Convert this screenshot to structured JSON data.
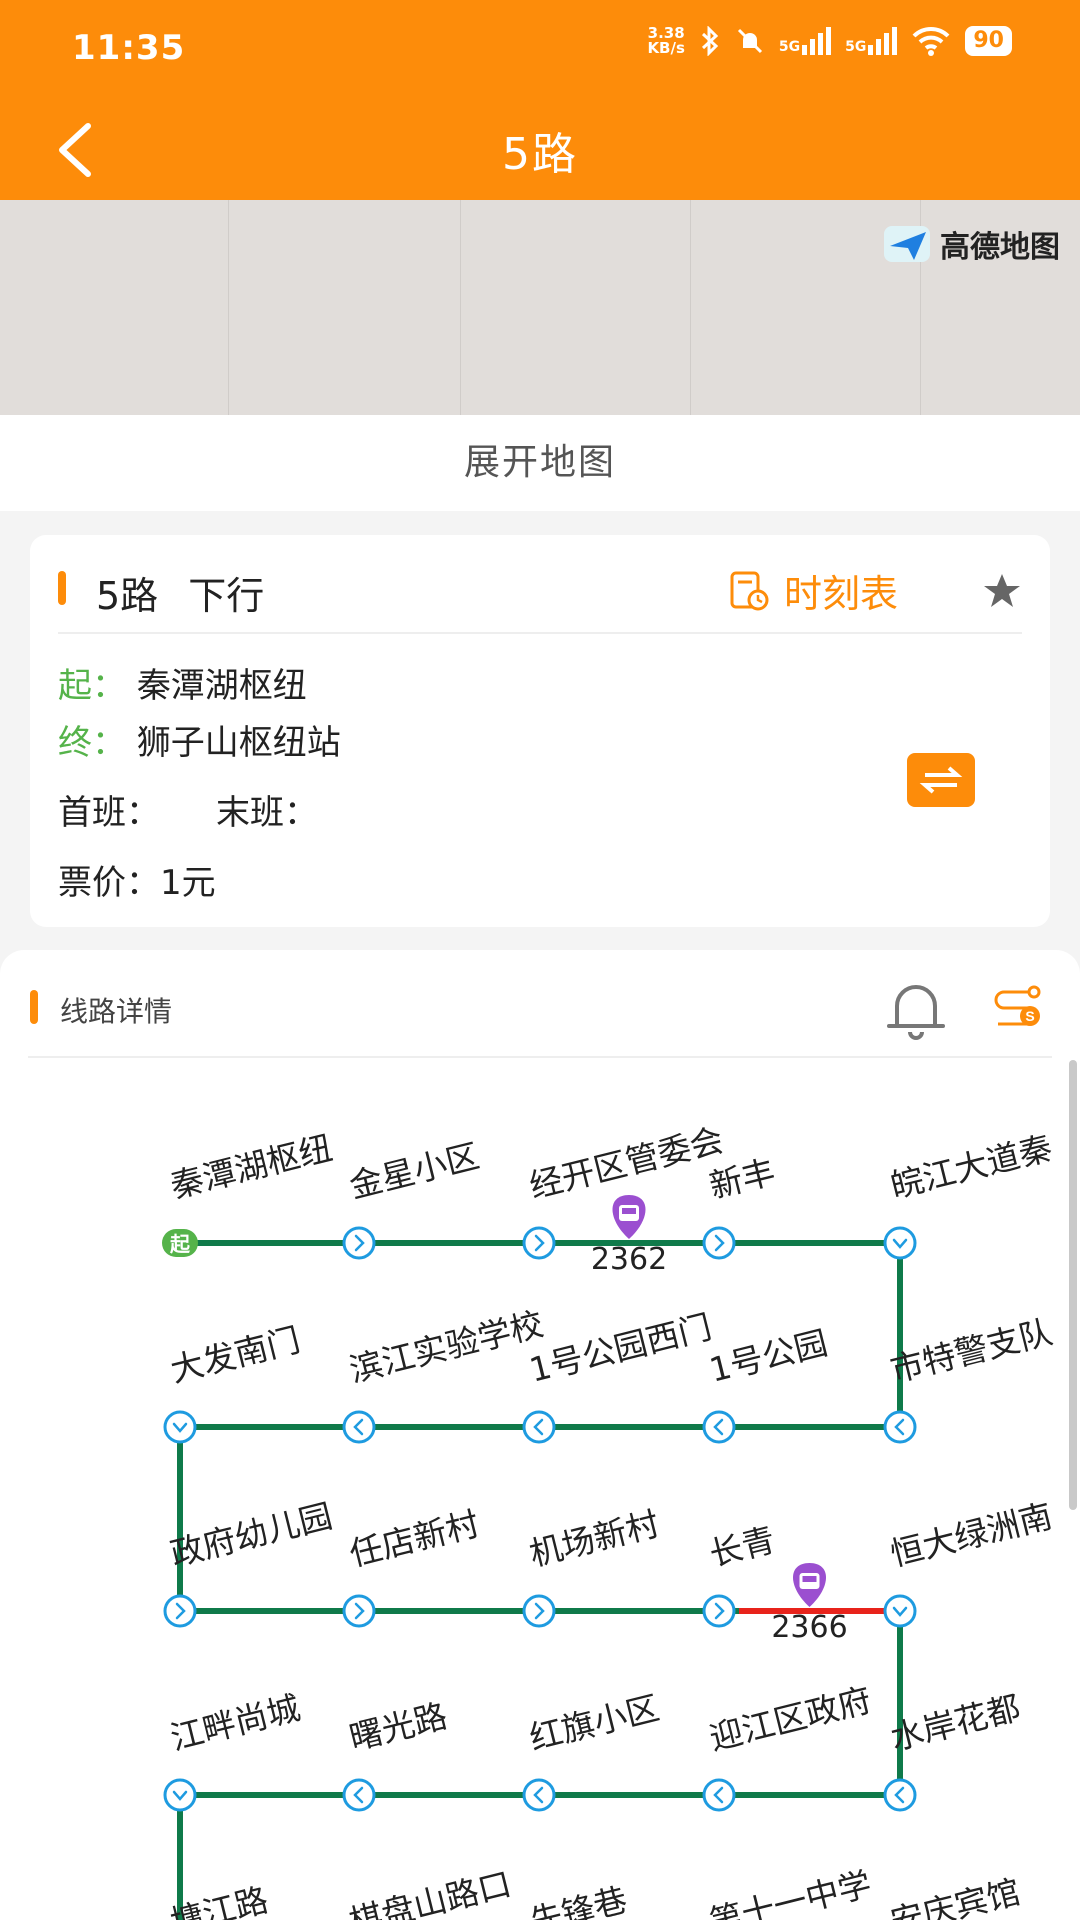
{
  "status": {
    "time": "11:35",
    "netspeed_value": "3.38",
    "netspeed_unit": "KB/s",
    "sig1": "5G",
    "sig2": "5G",
    "battery": "90"
  },
  "header": {
    "title": "5路",
    "back_icon": "chevron-left-icon"
  },
  "map": {
    "logo_text": "高德地图",
    "expand_label": "展开地图"
  },
  "line_card": {
    "route_name": "5路",
    "direction": "下行",
    "timetable_label": "时刻表",
    "start_label": "起：",
    "start_station": "秦潭湖枢纽",
    "end_label": "终：",
    "end_station": "狮子山枢纽站",
    "first_bus_label": "首班：",
    "last_bus_label": "末班：",
    "fare_label": "票价：",
    "fare_value": "1元",
    "accent_color": "#fd8c0a"
  },
  "detail": {
    "title": "线路详情",
    "start_badge": "起",
    "rows": [
      {
        "dir": "right",
        "stations": [
          "秦潭湖枢纽",
          "金星小区",
          "经开区管委会",
          "新丰",
          "皖江大道秦"
        ]
      },
      {
        "dir": "left",
        "stations": [
          "大发南门",
          "滨江实验学校",
          "1号公园西门",
          "1号公园",
          "市特警支队"
        ]
      },
      {
        "dir": "right",
        "stations": [
          "政府幼儿园",
          "任店新村",
          "机场新村",
          "长青",
          "恒大绿洲南"
        ]
      },
      {
        "dir": "left",
        "stations": [
          "江畔尚城",
          "曙光路",
          "红旗小区",
          "迎江区政府",
          "水岸花都"
        ]
      },
      {
        "dir": "right",
        "stations": [
          "墉江路",
          "棋盘山路口",
          "先锋巷",
          "第十一中学",
          "安庆宾馆"
        ]
      }
    ],
    "buses": [
      {
        "plate": "2362",
        "row": 0,
        "between": [
          2,
          3
        ]
      },
      {
        "plate": "2366",
        "row": 2,
        "between": [
          3,
          4
        ]
      }
    ],
    "line_color": "#0f7a4a",
    "congestion_color": "#e8231b",
    "node_color": "#1e9be0",
    "bus_color": "#9b4fd0"
  }
}
